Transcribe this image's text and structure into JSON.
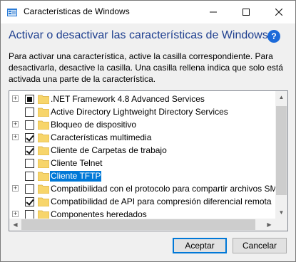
{
  "window": {
    "title": "Características de Windows",
    "minimize_glyph": "—",
    "maximize_glyph": "☐",
    "close_glyph": "✕"
  },
  "header": {
    "heading": "Activar o desactivar las características de Windows",
    "help_glyph": "?",
    "description": "Para activar una característica, active la casilla correspondiente. Para desactivarla, desactive la casilla. Una casilla rellena indica que solo está activada una parte de la característica."
  },
  "features": [
    {
      "label": ".NET Framework 4.8 Advanced Services",
      "state": "partial",
      "expandable": true
    },
    {
      "label": "Active Directory Lightweight Directory Services",
      "state": "unchecked",
      "expandable": false
    },
    {
      "label": "Bloqueo de dispositivo",
      "state": "unchecked",
      "expandable": true
    },
    {
      "label": "Características multimedia",
      "state": "checked",
      "expandable": true
    },
    {
      "label": "Cliente de Carpetas de trabajo",
      "state": "checked",
      "expandable": false
    },
    {
      "label": "Cliente Telnet",
      "state": "unchecked",
      "expandable": false
    },
    {
      "label": "Cliente TFTP",
      "state": "unchecked",
      "expandable": false,
      "selected": true
    },
    {
      "label": "Compatibilidad con el protocolo para compartir archivos SM",
      "state": "unchecked",
      "expandable": true
    },
    {
      "label": "Compatibilidad de API para compresión diferencial remota",
      "state": "checked",
      "expandable": false
    },
    {
      "label": "Componentes heredados",
      "state": "unchecked",
      "expandable": true
    }
  ],
  "buttons": {
    "ok": "Aceptar",
    "cancel": "Cancelar"
  },
  "colors": {
    "heading": "#1e3f8f",
    "selection": "#0078d7",
    "folder": "#f7d56b"
  }
}
